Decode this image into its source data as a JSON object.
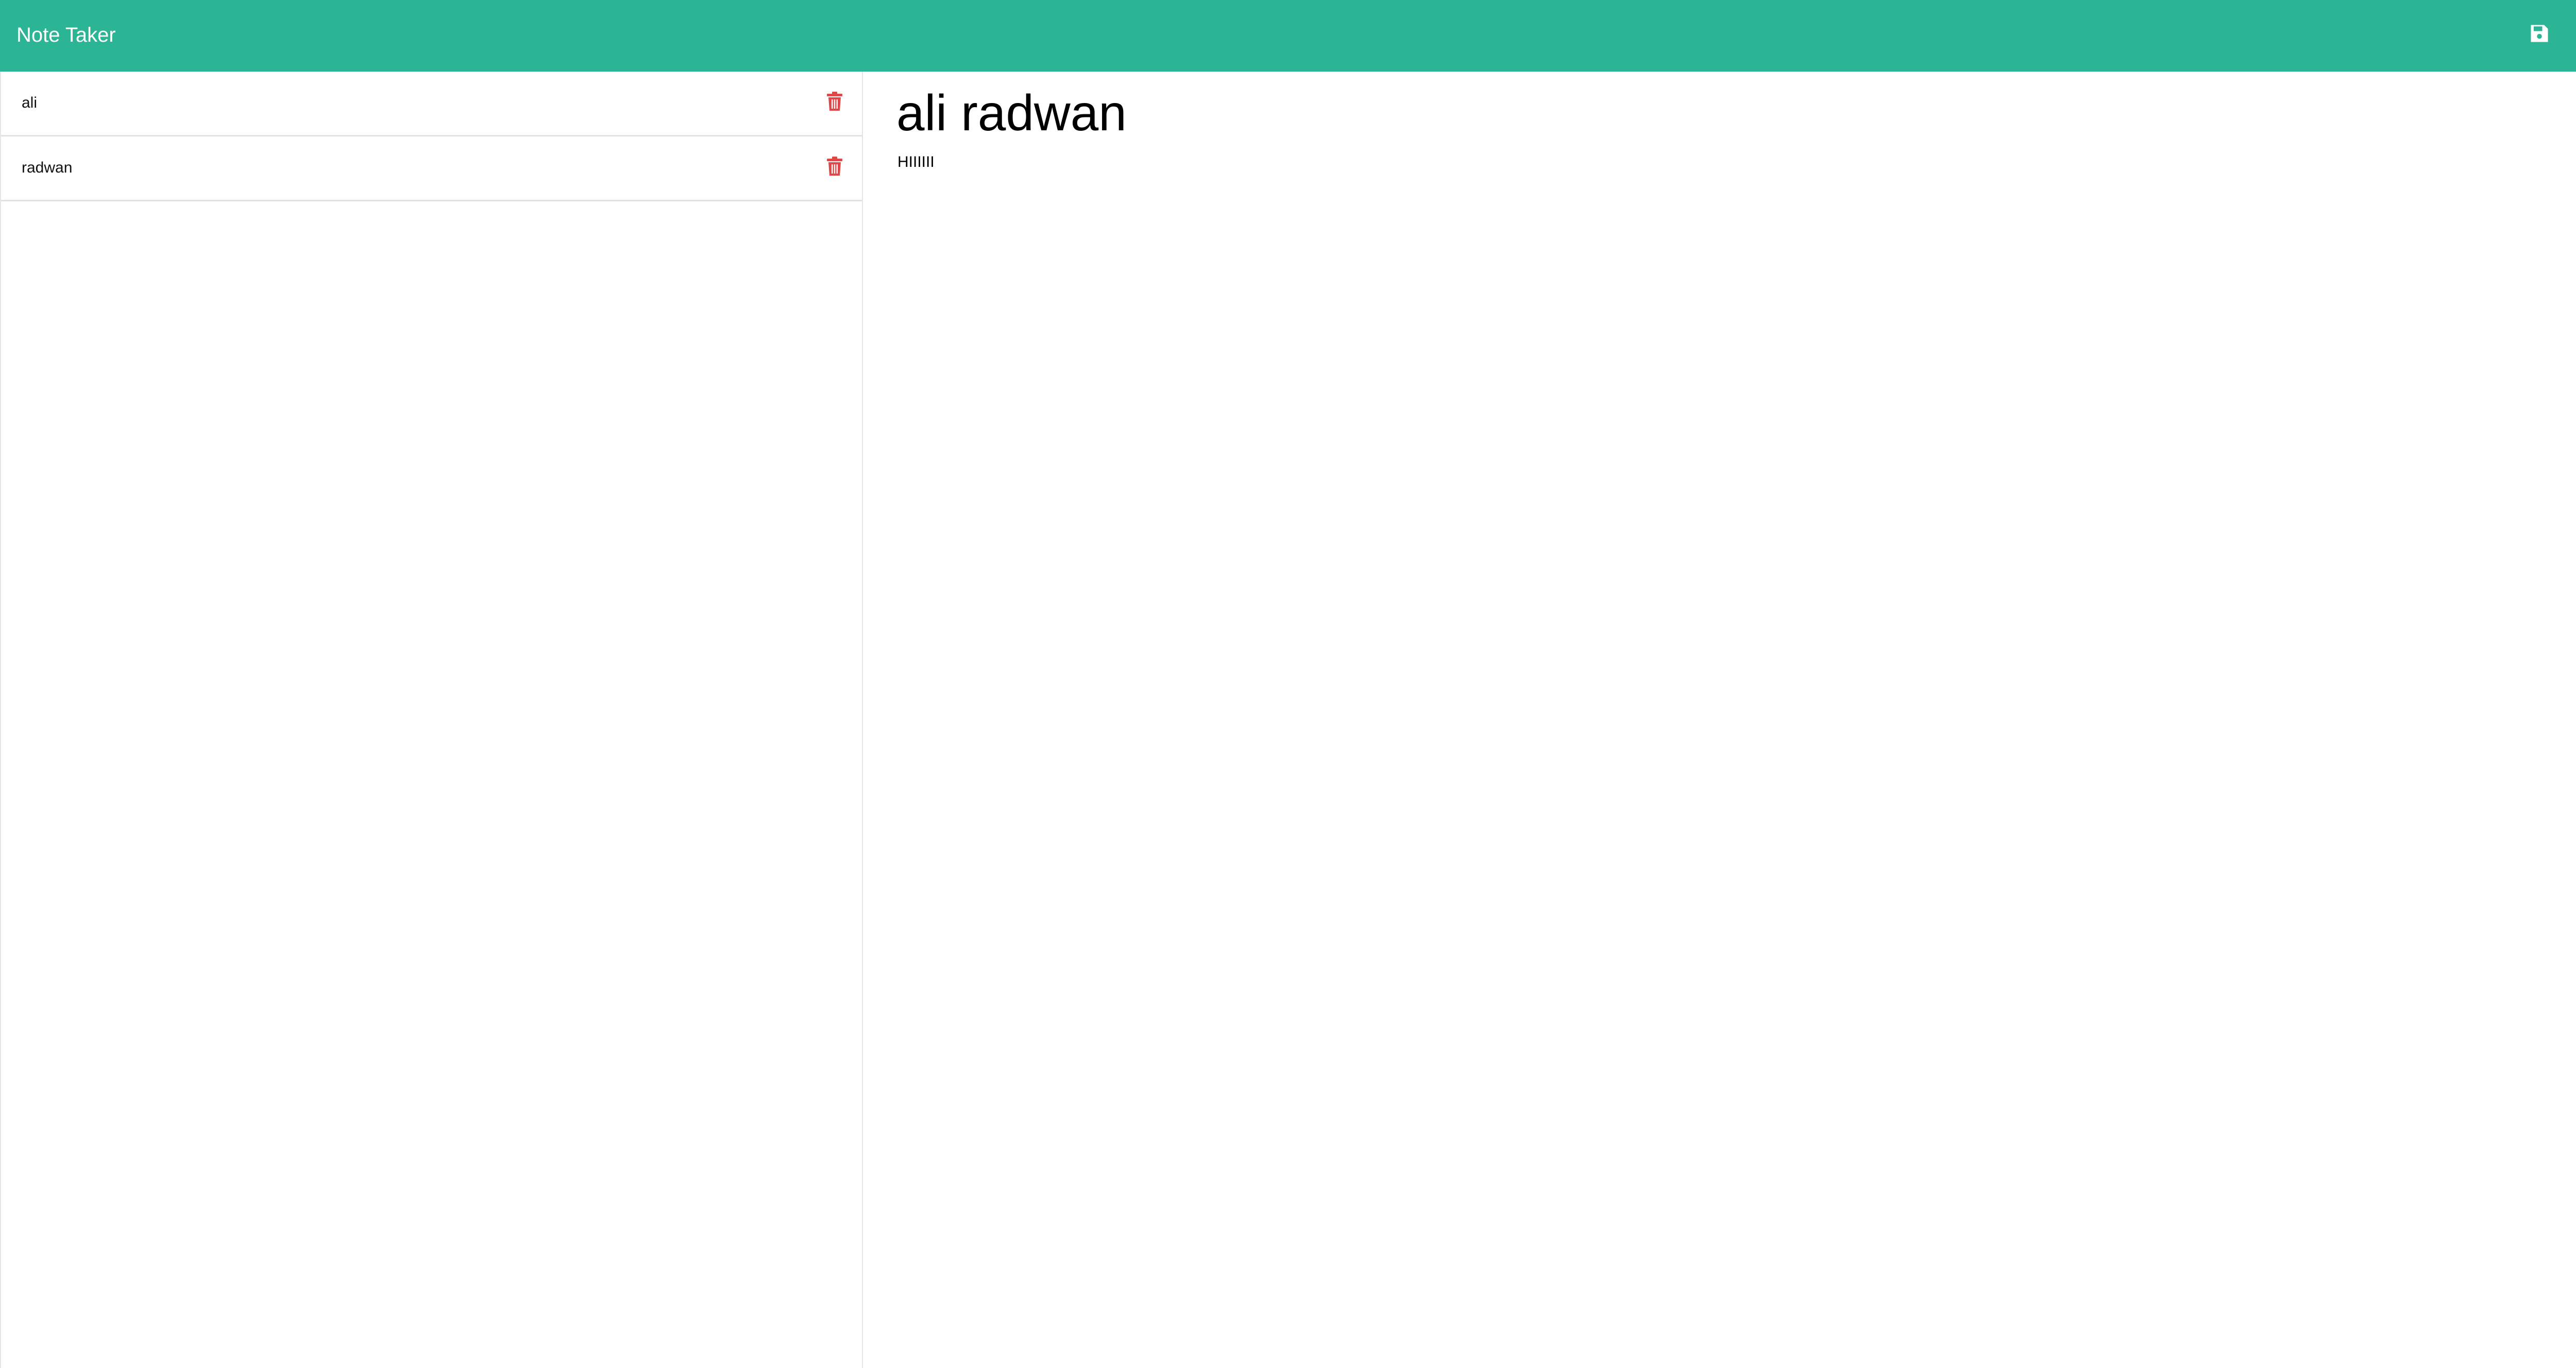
{
  "app": {
    "title": "Note Taker",
    "accent_color": "#2bb594",
    "delete_color": "#e04848"
  },
  "toolbar": {
    "save_icon": "save-icon",
    "add_icon": "plus-icon"
  },
  "notes": [
    {
      "title": "ali",
      "icon": "trash-icon"
    },
    {
      "title": "radwan",
      "icon": "trash-icon"
    }
  ],
  "active_note": {
    "title": "ali radwan",
    "text": "HIIIIII"
  }
}
